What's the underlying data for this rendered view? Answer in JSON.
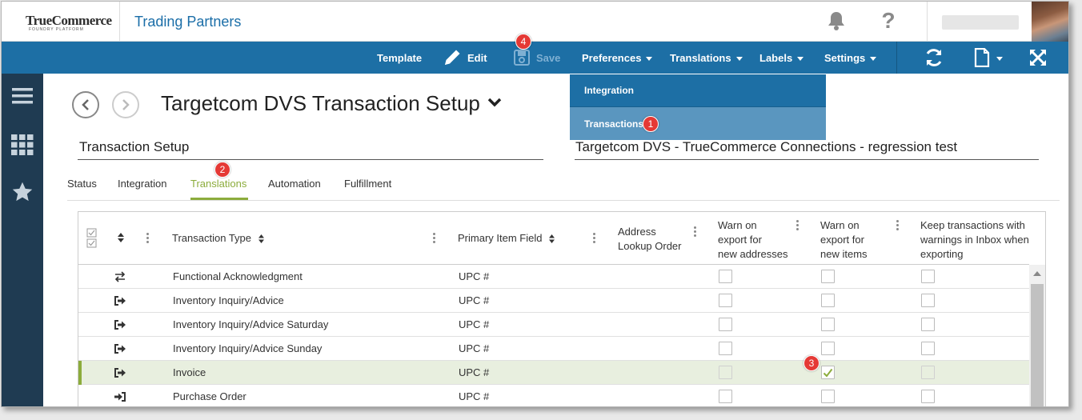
{
  "brand": {
    "logo": "TrueCommerce",
    "logo_sub": "FOUNDRY PLATFORM",
    "app_title": "Trading Partners"
  },
  "header": {
    "notification_icon": "bell-icon",
    "help_label": "?",
    "help_icon": "question-icon"
  },
  "toolbar": {
    "template": "Template",
    "edit": "Edit",
    "save": "Save",
    "preferences": "Preferences",
    "translations": "Translations",
    "labels": "Labels",
    "settings": "Settings",
    "icons": [
      "refresh-icon",
      "document-icon",
      "expand-icon"
    ]
  },
  "dropdown": {
    "items": [
      "Integration",
      "Transactions"
    ]
  },
  "page": {
    "title": "Targetcom DVS Transaction Setup",
    "section_left": "Transaction Setup",
    "section_right": "Targetcom DVS - TrueCommerce Connections - regression test"
  },
  "tabs": [
    "Status",
    "Integration",
    "Translations",
    "Automation",
    "Fulfillment"
  ],
  "active_tab": "Translations",
  "badges": [
    "1",
    "2",
    "3",
    "4"
  ],
  "grid": {
    "headers": {
      "transaction_type": "Transaction Type",
      "primary_item_field": "Primary Item Field",
      "address_lookup_1": "Address",
      "address_lookup_2": "Lookup Order",
      "warn_addr_1": "Warn on",
      "warn_addr_2": "export for",
      "warn_addr_3": "new addresses",
      "warn_items_1": "Warn on",
      "warn_items_2": "export for",
      "warn_items_3": "new items",
      "keep_1": "Keep transactions with",
      "keep_2": "warnings in Inbox when",
      "keep_3": "exporting"
    },
    "rows": [
      {
        "type": "Functional Acknowledgment",
        "field": "UPC #",
        "direction": "bidirectional",
        "warn_addr": false,
        "warn_items": false,
        "keep": false
      },
      {
        "type": "Inventory Inquiry/Advice",
        "field": "UPC #",
        "direction": "outbound",
        "warn_addr": false,
        "warn_items": false,
        "keep": false
      },
      {
        "type": "Inventory Inquiry/Advice Saturday",
        "field": "UPC #",
        "direction": "outbound",
        "warn_addr": false,
        "warn_items": false,
        "keep": false
      },
      {
        "type": "Inventory Inquiry/Advice Sunday",
        "field": "UPC #",
        "direction": "outbound",
        "warn_addr": false,
        "warn_items": false,
        "keep": false
      },
      {
        "type": "Invoice",
        "field": "UPC #",
        "direction": "outbound",
        "warn_addr": false,
        "warn_items": true,
        "keep": false,
        "selected": true
      },
      {
        "type": "Purchase Order",
        "field": "UPC #",
        "direction": "inbound",
        "warn_addr": false,
        "warn_items": false,
        "keep": false
      }
    ]
  },
  "colors": {
    "toolbar": "#1d6fa5",
    "sidenav": "#1f3b52",
    "accent_green": "#8cac3c",
    "badge_red": "#e53935",
    "title_blue": "#1b6ea8"
  }
}
